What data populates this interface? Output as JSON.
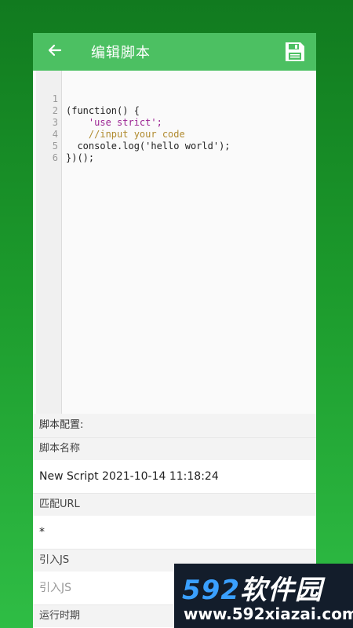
{
  "header": {
    "title": "编辑脚本",
    "back_icon": "arrow-left-icon",
    "save_icon": "floppy-disk-icon"
  },
  "editor": {
    "line_numbers": [
      "1",
      "2",
      "3",
      "4",
      "5",
      "6"
    ],
    "lines": [
      "(function() {",
      "    'use strict';",
      "    //input your code",
      "  console.log('hello world');",
      "})();",
      ""
    ]
  },
  "config": {
    "section_title": "脚本配置:",
    "fields": [
      {
        "label": "脚本名称",
        "value": "New Script 2021-10-14 11:18:24",
        "placeholder": ""
      },
      {
        "label": "匹配URL",
        "value": "*",
        "placeholder": ""
      },
      {
        "label": "引入JS",
        "value": "",
        "placeholder": "引入JS"
      },
      {
        "label": "运行时期",
        "value": "",
        "placeholder": ""
      }
    ]
  },
  "watermark": {
    "number": "592",
    "text": "软件园",
    "url": "www.592xiazai.com"
  },
  "colors": {
    "toolbar": "#4cc062",
    "background_top": "#117a1f",
    "background_bottom": "#2fbd45"
  }
}
